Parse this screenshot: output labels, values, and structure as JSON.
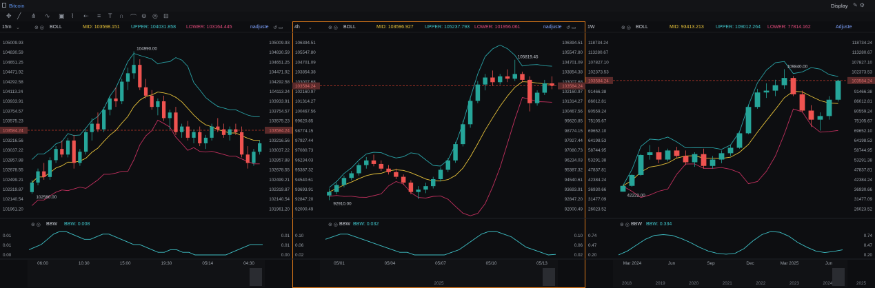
{
  "app": {
    "title": "Bitcoin",
    "display_label": "Display"
  },
  "colors": {
    "up": "#26a69a",
    "down": "#ef5350",
    "mid": "#e8c33a",
    "upper": "#2aa3a7",
    "lower": "#c2305e",
    "bbw": "#3fc2c8",
    "price_line": "#c0392b"
  },
  "panels": [
    {
      "timeframe": "15m",
      "indicator": "BOLL",
      "mid": "MID: 103598.151",
      "upper": "UPPER: 104031.858",
      "lower": "LOWER: 103164.445",
      "adjust": "nadjuste",
      "bbw_label": "BBW",
      "bbw_value": "BBW: 0.008",
      "price_label": "103584.24",
      "high_label": "104990.00",
      "low_label": "102580.00",
      "left_axis": [
        "105009.93",
        "104830.59",
        "104651.25",
        "104471.92",
        "104292.58",
        "104113.24",
        "103933.91",
        "103754.57",
        "103575.23",
        "103395.90",
        "103216.56",
        "103037.22",
        "102857.88",
        "102678.55",
        "102499.21",
        "102319.87",
        "102140.54",
        "101961.20"
      ],
      "right_axis": [
        "105009.93",
        "104830.59",
        "104651.25",
        "104471.92",
        "104292.58",
        "104113.24",
        "103933.91",
        "103754.57",
        "103575.23",
        "103395.90",
        "103216.56",
        "103037.22",
        "102857.88",
        "102678.55",
        "102499.21",
        "102319.87",
        "102140.54",
        "101961.20"
      ],
      "bbw_axis": [
        "0.01",
        "0.01",
        "0.00"
      ],
      "time_axis": [
        "06:00",
        "10:30",
        "15:00",
        "19:30",
        "05/14",
        "04:30"
      ],
      "year_axis": []
    },
    {
      "timeframe": "4h",
      "indicator": "BOLL",
      "mid": "MID: 103596.927",
      "upper": "UPPER: 105237.793",
      "lower": "LOWER: 101956.061",
      "adjust": "nadjuste",
      "bbw_label": "BBW",
      "bbw_value": "BBW: 0.032",
      "price_label": "103584.24",
      "high_label": "105819.45",
      "low_label": "92910.00",
      "left_axis": [
        "106394.51",
        "105547.80",
        "104701.09",
        "103854.38",
        "103007.68",
        "102160.97",
        "101314.27",
        "100467.56",
        "99620.85",
        "98774.15",
        "97927.44",
        "97080.73",
        "96234.03",
        "95387.32",
        "94540.61",
        "93693.91",
        "92847.20",
        "92000.49"
      ],
      "right_axis": [
        "106394.51",
        "105547.80",
        "104701.09",
        "103854.38",
        "103007.68",
        "102160.97",
        "101314.27",
        "100467.56",
        "99620.85",
        "98774.15",
        "97927.44",
        "97080.73",
        "96234.03",
        "95387.32",
        "94540.61",
        "93693.91",
        "92847.20",
        "92000.49"
      ],
      "bbw_axis": [
        "0.10",
        "0.06",
        "0.02"
      ],
      "time_axis": [
        "05/01",
        "05/04",
        "05/07",
        "05/10",
        "05/13"
      ],
      "year_axis": [
        "2025"
      ]
    },
    {
      "timeframe": "1W",
      "indicator": "BOLL",
      "mid": "MID: 93413.213",
      "upper": "UPPER: 109012.264",
      "lower": "LOWER: 77814.162",
      "adjust": "Adjuste",
      "bbw_label": "BBW",
      "bbw_value": "BBW: 0.334",
      "price_label": "103584.24",
      "high_label": "109840.00",
      "low_label": "42222.00",
      "left_axis": [
        "118734.24",
        "113280.67",
        "107827.10",
        "102373.53",
        "96919.96",
        "91466.38",
        "86012.81",
        "80559.24",
        "75105.67",
        "69652.10",
        "64198.53",
        "58744.95",
        "53291.38",
        "47837.81",
        "42384.24",
        "36930.66",
        "31477.09",
        "26023.52"
      ],
      "right_axis": [
        "118734.24",
        "113280.67",
        "107827.10",
        "102373.53",
        "96919.96",
        "91466.38",
        "86012.81",
        "80559.24",
        "75105.67",
        "69652.10",
        "64198.53",
        "58744.95",
        "53291.38",
        "47837.81",
        "42384.24",
        "36930.66",
        "31477.09",
        "26023.52"
      ],
      "bbw_axis": [
        "0.74",
        "0.47",
        "0.20"
      ],
      "time_axis": [
        "Mar 2024",
        "Jun",
        "Sep",
        "Dec",
        "Mar 2025",
        "Jun"
      ],
      "year_axis": [
        "2018",
        "2019",
        "2020",
        "2021",
        "2022",
        "2023",
        "2024",
        "2025"
      ]
    }
  ],
  "chart_data": [
    {
      "type": "candlestick",
      "timeframe": "15m",
      "ylim": [
        101961.2,
        105009.93
      ],
      "ohlc": [
        [
          102480,
          102700,
          102450,
          102650
        ],
        [
          102650,
          102900,
          102600,
          102850
        ],
        [
          102850,
          103000,
          102700,
          102750
        ],
        [
          102750,
          103100,
          102700,
          103050
        ],
        [
          103050,
          103300,
          103000,
          103250
        ],
        [
          103250,
          103400,
          103100,
          103150
        ],
        [
          103150,
          103450,
          103100,
          103400
        ],
        [
          103400,
          103500,
          102900,
          103000
        ],
        [
          103000,
          103250,
          102950,
          103200
        ],
        [
          103200,
          103600,
          103150,
          103550
        ],
        [
          103550,
          103800,
          103400,
          103700
        ],
        [
          103700,
          103900,
          103550,
          103600
        ],
        [
          103600,
          104000,
          103550,
          103950
        ],
        [
          103950,
          104200,
          103850,
          104150
        ],
        [
          104150,
          104350,
          104000,
          104100
        ],
        [
          104100,
          104500,
          104050,
          104450
        ],
        [
          104450,
          104700,
          104300,
          104600
        ],
        [
          104600,
          104990,
          104500,
          104750
        ],
        [
          104750,
          104850,
          104300,
          104350
        ],
        [
          104350,
          104500,
          104150,
          104200
        ],
        [
          104200,
          104300,
          103950,
          104000
        ],
        [
          104000,
          104150,
          103850,
          104100
        ],
        [
          104100,
          104200,
          103750,
          103800
        ],
        [
          103800,
          103950,
          103600,
          103900
        ],
        [
          103900,
          104000,
          103500,
          103550
        ],
        [
          103550,
          103700,
          103450,
          103650
        ],
        [
          103650,
          103750,
          103400,
          103450
        ],
        [
          103450,
          103600,
          103350,
          103550
        ],
        [
          103550,
          103650,
          103300,
          103350
        ],
        [
          103350,
          103500,
          103250,
          103450
        ],
        [
          103450,
          103700,
          103400,
          103650
        ],
        [
          103650,
          103800,
          103550,
          103600
        ],
        [
          103600,
          103700,
          103450,
          103500
        ],
        [
          103500,
          103650,
          103400,
          103600
        ],
        [
          103600,
          103700,
          103500,
          103550
        ],
        [
          103550,
          103650,
          103100,
          103150
        ],
        [
          103150,
          103300,
          102900,
          103000
        ],
        [
          103000,
          103250,
          102950,
          103200
        ],
        [
          103200,
          103400,
          103150,
          103350
        ]
      ],
      "bbw": [
        0.006,
        0.007,
        0.008,
        0.01,
        0.012,
        0.013,
        0.013,
        0.012,
        0.011,
        0.01,
        0.01,
        0.011,
        0.012,
        0.012,
        0.011,
        0.01,
        0.009,
        0.008,
        0.008,
        0.007,
        0.006,
        0.005,
        0.005,
        0.006,
        0.006,
        0.005,
        0.005,
        0.004,
        0.004,
        0.004,
        0.004,
        0.004,
        0.004,
        0.005,
        0.006,
        0.007,
        0.008,
        0.008,
        0.008
      ]
    },
    {
      "type": "candlestick",
      "timeframe": "4h",
      "ylim": [
        92000.49,
        106394.51
      ],
      "ohlc": [
        [
          94200,
          94800,
          93800,
          94500
        ],
        [
          94500,
          95300,
          94300,
          95100
        ],
        [
          95100,
          95900,
          94900,
          95700
        ],
        [
          95700,
          96300,
          95500,
          96100
        ],
        [
          96100,
          97000,
          95900,
          96800
        ],
        [
          96800,
          97500,
          96500,
          97200
        ],
        [
          97200,
          97700,
          96700,
          96900
        ],
        [
          96900,
          97200,
          96300,
          96500
        ],
        [
          96500,
          96800,
          96000,
          96200
        ],
        [
          96200,
          96500,
          95600,
          95800
        ],
        [
          95800,
          96000,
          95100,
          95300
        ],
        [
          95300,
          95500,
          94300,
          94500
        ],
        [
          94500,
          95000,
          93900,
          94700
        ],
        [
          94700,
          95300,
          94400,
          95000
        ],
        [
          95000,
          95800,
          94800,
          95600
        ],
        [
          95600,
          96600,
          95400,
          96400
        ],
        [
          96400,
          97400,
          96200,
          97200
        ],
        [
          97200,
          98800,
          97000,
          98600
        ],
        [
          98600,
          100600,
          98400,
          100300
        ],
        [
          100300,
          102600,
          100000,
          102300
        ],
        [
          102300,
          104000,
          102100,
          103700
        ],
        [
          103700,
          104600,
          103200,
          104300
        ],
        [
          104300,
          104900,
          103600,
          103900
        ],
        [
          103900,
          104600,
          103700,
          104400
        ],
        [
          104400,
          105000,
          103900,
          104200
        ],
        [
          104200,
          105820,
          104000,
          104600
        ],
        [
          104600,
          104800,
          103900,
          104100
        ],
        [
          104100,
          104400,
          101400,
          102100
        ],
        [
          102100,
          103200,
          101900,
          103000
        ],
        [
          103000,
          104100,
          102800,
          103800
        ],
        [
          103800,
          104400,
          103300,
          103600
        ]
      ],
      "bbw": [
        0.09,
        0.1,
        0.11,
        0.11,
        0.1,
        0.09,
        0.08,
        0.07,
        0.06,
        0.05,
        0.04,
        0.04,
        0.03,
        0.03,
        0.03,
        0.03,
        0.03,
        0.04,
        0.05,
        0.07,
        0.09,
        0.11,
        0.12,
        0.12,
        0.11,
        0.1,
        0.08,
        0.06,
        0.05,
        0.04,
        0.03,
        0.032
      ]
    },
    {
      "type": "candlestick",
      "timeframe": "1W",
      "ylim": [
        26023.52,
        118734.24
      ],
      "ohlc": [
        [
          42300,
          46000,
          42222,
          45500
        ],
        [
          45500,
          52000,
          45000,
          51500
        ],
        [
          51500,
          63000,
          51000,
          62500
        ],
        [
          62500,
          68000,
          60000,
          64000
        ],
        [
          64000,
          67000,
          58000,
          60000
        ],
        [
          60000,
          66000,
          59000,
          65000
        ],
        [
          65000,
          67000,
          61000,
          62000
        ],
        [
          62000,
          65000,
          57000,
          58500
        ],
        [
          58500,
          64000,
          56000,
          63000
        ],
        [
          63000,
          66000,
          55000,
          56500
        ],
        [
          56500,
          62000,
          55000,
          60000
        ],
        [
          60000,
          65000,
          58000,
          63500
        ],
        [
          63500,
          68000,
          62000,
          66500
        ],
        [
          66500,
          75000,
          66000,
          74500
        ],
        [
          74500,
          90000,
          74000,
          89000
        ],
        [
          89000,
          99000,
          88000,
          97000
        ],
        [
          97000,
          102000,
          94000,
          98000
        ],
        [
          98000,
          104000,
          95000,
          101000
        ],
        [
          101000,
          109840,
          99000,
          105000
        ],
        [
          105000,
          106000,
          95000,
          96000
        ],
        [
          96000,
          98000,
          86000,
          87000
        ],
        [
          87000,
          90000,
          78000,
          82000
        ],
        [
          82000,
          86000,
          76000,
          84000
        ],
        [
          84000,
          95000,
          82000,
          93000
        ],
        [
          93000,
          104000,
          92000,
          103500
        ]
      ],
      "bbw": [
        0.2,
        0.3,
        0.45,
        0.6,
        0.7,
        0.72,
        0.7,
        0.62,
        0.52,
        0.4,
        0.3,
        0.24,
        0.22,
        0.24,
        0.36,
        0.56,
        0.72,
        0.8,
        0.78,
        0.68,
        0.52,
        0.4,
        0.3,
        0.26,
        0.29,
        0.33
      ]
    }
  ]
}
